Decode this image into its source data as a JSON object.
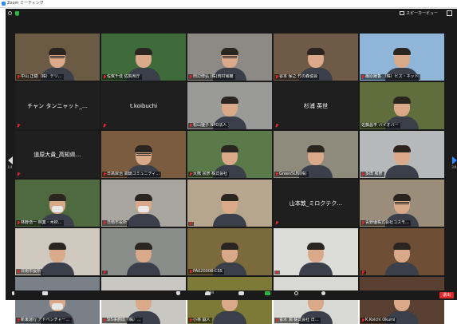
{
  "window": {
    "title": "Zoom ミーティング"
  },
  "topbar": {
    "speaker_view_label": "スピーカービュー"
  },
  "pagination": {
    "left_page": "1/4",
    "right_page": "3/4"
  },
  "tiles": [
    {
      "name": "中山 正樹（株）テリ…",
      "kind": "video",
      "muted": true
    },
    {
      "name": "佐賀千佳 佐賀県庁",
      "kind": "video",
      "muted": true
    },
    {
      "name": "田辺修弘 (株)田村電機",
      "kind": "video",
      "muted": true
    },
    {
      "name": "谷本 保之 竹の森協会",
      "kind": "video",
      "muted": true
    },
    {
      "name": "篠原綾香 （株）ビズ・ネット",
      "kind": "video",
      "muted": true
    },
    {
      "name": "チャン タンニャット_…",
      "kind": "name",
      "muted": true
    },
    {
      "name": "t.koibuchi",
      "kind": "name",
      "muted": true
    },
    {
      "name": "松山優子 NPO法人",
      "kind": "video",
      "muted": true
    },
    {
      "name": "杉浦 英世",
      "kind": "name",
      "muted": true
    },
    {
      "name": "佐藤昌平 バイオバー",
      "kind": "video",
      "muted": false,
      "active": true
    },
    {
      "name": "道原大貴_高知県…",
      "kind": "name",
      "muted": true
    },
    {
      "name": "日高岸治 高鍋コミュニティ…",
      "kind": "video",
      "muted": true
    },
    {
      "name": "大熊 宗彦 株式会社",
      "kind": "video",
      "muted": true
    },
    {
      "name": "GreenSUN(株)",
      "kind": "video",
      "muted": true
    },
    {
      "name": "多田 和彦",
      "kind": "video",
      "muted": true
    },
    {
      "name": "林野浩一 林業・木材…",
      "kind": "video",
      "muted": true
    },
    {
      "name": "日南市役所",
      "kind": "video",
      "muted": true
    },
    {
      "name": "",
      "kind": "video",
      "muted": true
    },
    {
      "name": "山本敦_ミロクテク…",
      "kind": "name",
      "muted": true
    },
    {
      "name": "青野優株式会社コスモ…",
      "kind": "video",
      "muted": true
    },
    {
      "name": "日南市役所",
      "kind": "video",
      "muted": true
    },
    {
      "name": "",
      "kind": "video",
      "muted": true
    },
    {
      "name": "PA020008-CSS",
      "kind": "video",
      "muted": true
    },
    {
      "name": "",
      "kind": "video",
      "muted": true
    },
    {
      "name": "",
      "kind": "video",
      "muted": true
    },
    {
      "name": "新東運行 アドベンチャー…",
      "kind": "video",
      "muted": true
    },
    {
      "name": "SIS事務局（株）…",
      "kind": "video",
      "muted": true
    },
    {
      "name": "小林 誠人",
      "kind": "video",
      "muted": true
    },
    {
      "name": "青木 潤 株式会社 日…",
      "kind": "video",
      "muted": true
    },
    {
      "name": "K.Koichi Okumi",
      "kind": "video",
      "muted": true
    }
  ],
  "toolbar": {
    "participants_count": "84",
    "leave_label": "退出"
  }
}
